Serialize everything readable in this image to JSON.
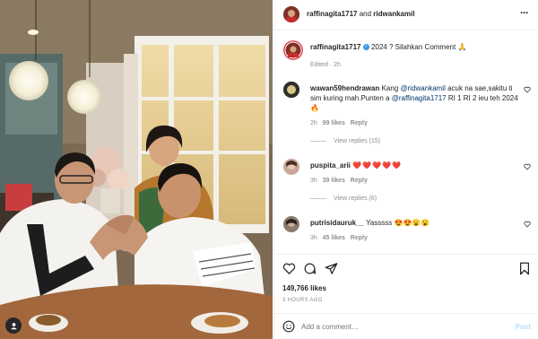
{
  "header": {
    "user1": "raffinagita1717",
    "joiner": "and",
    "user2": "ridwankamil",
    "more": "···"
  },
  "caption": {
    "username": "raffinagita1717",
    "text": "2024 ? Silahkan Comment 🙏",
    "meta": "Edited · 2h"
  },
  "comments": [
    {
      "username": "wawan59hendrawan",
      "text_a": "Kang ",
      "mention1": "@ridwankamil",
      "text_b": " acuk na sae,sakitu ti sim kuring mah.Punten a ",
      "mention2": "@raffinagita1717",
      "text_c": " RI 1 RI 2 ieu teh 2024 🔥",
      "time": "2h",
      "likes": "99 likes",
      "reply": "Reply",
      "view_replies": "View replies (15)"
    },
    {
      "username": "puspita_arii",
      "text": "❤️❤️❤️❤️❤️",
      "time": "3h",
      "likes": "39 likes",
      "reply": "Reply",
      "view_replies": "View replies (6)"
    },
    {
      "username": "putrisidauruk__",
      "text": "Yasssss 😍😍😮😮",
      "time": "3h",
      "likes": "45 likes",
      "reply": "Reply"
    }
  ],
  "post": {
    "likes": "149,766 likes",
    "time_ago": "3 HOURS AGO"
  },
  "add_comment": {
    "placeholder": "Add a comment…",
    "post": "Post"
  },
  "colors": {
    "verified": "#3897f0",
    "link": "#00376b",
    "muted": "#8e8e8e",
    "post_disabled": "#b2dffc"
  }
}
